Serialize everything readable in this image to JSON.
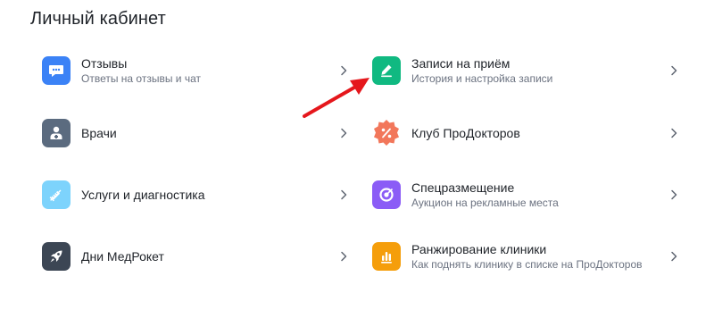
{
  "page": {
    "title": "Личный кабинет"
  },
  "colors": {
    "reviews": "#3b82f6",
    "doctors": "#5b6b7f",
    "services": "#7dd3fc",
    "medrocket": "#3c4654",
    "appointments": "#10b981",
    "club": "#f2775b",
    "placement": "#8b5cf6",
    "ranking": "#f59e0b",
    "annotation_arrow": "#e5171c"
  },
  "items": {
    "reviews": {
      "label": "Отзывы",
      "sub": "Ответы на отзывы и чат",
      "icon": "chat-icon"
    },
    "doctors": {
      "label": "Врачи",
      "icon": "doctor-icon"
    },
    "services": {
      "label": "Услуги и диагностика",
      "icon": "syringe-icon"
    },
    "medrocket": {
      "label": "Дни МедРокет",
      "icon": "rocket-icon"
    },
    "appointments": {
      "label": "Записи на приём",
      "sub": "История и настройка записи",
      "icon": "pencil-icon"
    },
    "club": {
      "label": "Клуб ПроДокторов",
      "icon": "discount-badge-icon"
    },
    "placement": {
      "label": "Спецразмещение",
      "sub": "Аукцион на рекламные места",
      "icon": "target-icon"
    },
    "ranking": {
      "label": "Ранжирование клиники",
      "sub": "Как поднять клинику в списке на ПроДокторов",
      "icon": "bar-chart-icon"
    }
  }
}
